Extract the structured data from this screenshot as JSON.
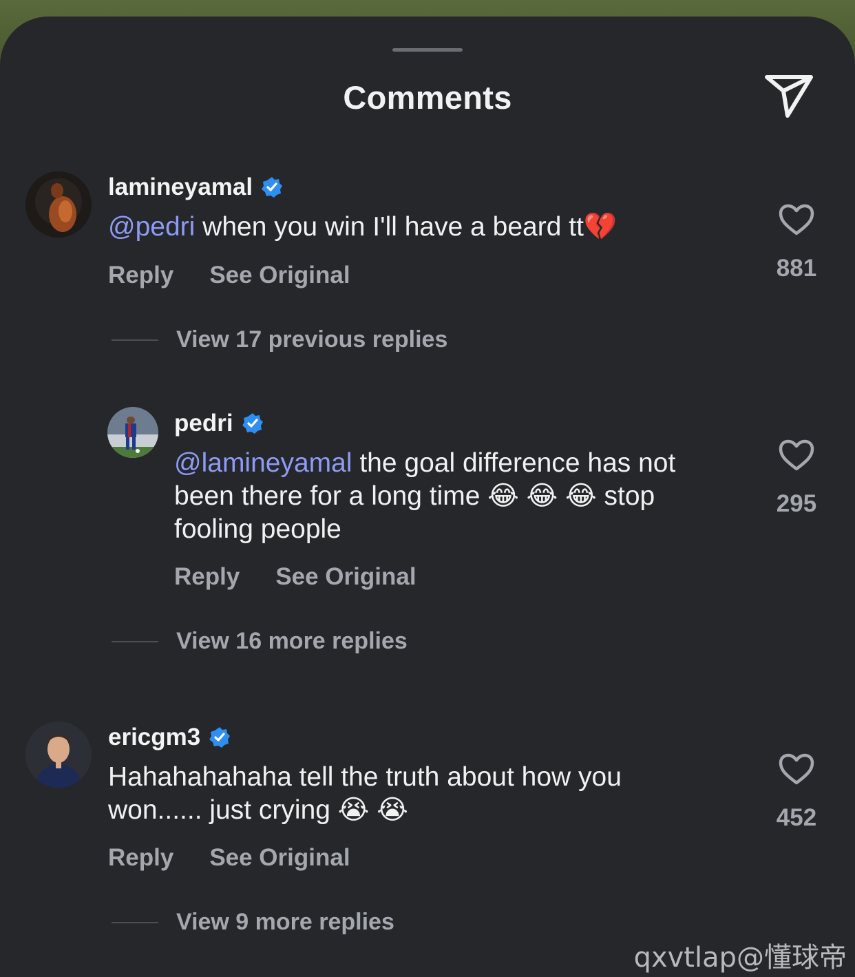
{
  "header": {
    "title": "Comments",
    "send_icon": "send-icon"
  },
  "comments": [
    {
      "username": "lamineyamal",
      "verified": true,
      "mention": "@pedri",
      "text": " when you win I'll have a beard tt",
      "emoji": "💔",
      "reply_label": "Reply",
      "see_original_label": "See Original",
      "likes": "881",
      "view_replies_label": "View 17 previous replies"
    },
    {
      "username": "pedri",
      "verified": true,
      "mention": "@lamineyamal",
      "text": " the goal difference has not been there for a long time 😂 😂 😂 stop fooling people",
      "reply_label": "Reply",
      "see_original_label": "See Original",
      "likes": "295",
      "view_replies_label": "View 16 more replies"
    },
    {
      "username": "ericgm3",
      "verified": true,
      "text": "Hahahahahaha tell the truth about how you won...... just crying 😭 😭",
      "reply_label": "Reply",
      "see_original_label": "See Original",
      "likes": "452",
      "view_replies_label": "View 9 more replies"
    }
  ],
  "watermark": "qxvtlap@懂球帝",
  "colors": {
    "sheet_background": "#25272b",
    "mention": "#8e9bf4",
    "verified_badge": "#2f8ff0",
    "secondary_text": "#a4a7ad"
  }
}
